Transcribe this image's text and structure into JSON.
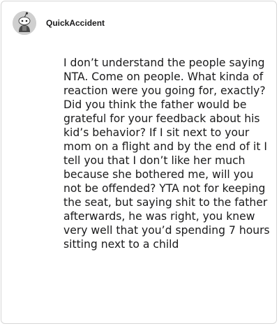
{
  "post": {
    "avatar_icon": "snoo-avatar-icon",
    "username": "QuickAccident",
    "comment_text": "I don’t understand the people saying NTA. Come on people. What kinda of reaction were you going for, exactly? Did you think the father would be grateful for your feedback about his kid’s behavior? If I sit next to your mom on a flight and by the end of it I tell you that I don’t like her much because she bothered me, will you not be offended? YTA not for keeping the seat, but saying shit to the father afterwards, he was right, you knew very well that you’d spending 7 hours sitting next to a child"
  }
}
